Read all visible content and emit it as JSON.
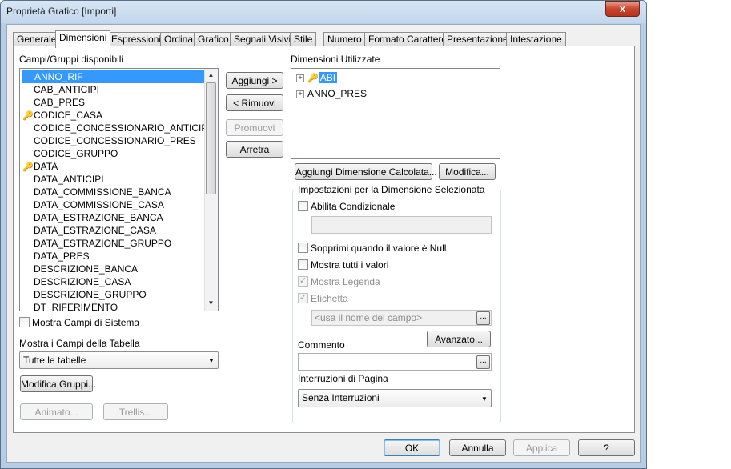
{
  "window": {
    "title": "Proprietà Grafico [Importi]",
    "close_glyph": "x"
  },
  "tabs": [
    {
      "label": "Generale"
    },
    {
      "label": "Dimensioni"
    },
    {
      "label": "Espressioni"
    },
    {
      "label": "Ordina"
    },
    {
      "label": "Grafico"
    },
    {
      "label": "Segnali Visivi"
    },
    {
      "label": "Stile"
    },
    {
      "label": "Numero"
    },
    {
      "label": "Formato Carattere"
    },
    {
      "label": "Presentazione"
    },
    {
      "label": "Intestazione"
    }
  ],
  "available": {
    "label": "Campi/Gruppi disponibili",
    "items": [
      {
        "text": "ANNO_RIF",
        "key": false
      },
      {
        "text": "CAB_ANTICIPI",
        "key": false
      },
      {
        "text": "CAB_PRES",
        "key": false
      },
      {
        "text": "CODICE_CASA",
        "key": true
      },
      {
        "text": "CODICE_CONCESSIONARIO_ANTICIPI",
        "key": false
      },
      {
        "text": "CODICE_CONCESSIONARIO_PRES",
        "key": false
      },
      {
        "text": "CODICE_GRUPPO",
        "key": false
      },
      {
        "text": "DATA",
        "key": true
      },
      {
        "text": "DATA_ANTICIPI",
        "key": false
      },
      {
        "text": "DATA_COMMISSIONE_BANCA",
        "key": false
      },
      {
        "text": "DATA_COMMISSIONE_CASA",
        "key": false
      },
      {
        "text": "DATA_ESTRAZIONE_BANCA",
        "key": false
      },
      {
        "text": "DATA_ESTRAZIONE_CASA",
        "key": false
      },
      {
        "text": "DATA_ESTRAZIONE_GRUPPO",
        "key": false
      },
      {
        "text": "DATA_PRES",
        "key": false
      },
      {
        "text": "DESCRIZIONE_BANCA",
        "key": false
      },
      {
        "text": "DESCRIZIONE_CASA",
        "key": false
      },
      {
        "text": "DESCRIZIONE_GRUPPO",
        "key": false
      },
      {
        "text": "DT_RIFERIMENTO",
        "key": false
      }
    ],
    "show_system_fields": "Mostra Campi di Sistema",
    "show_fields_of_table": "Mostra i Campi della Tabella",
    "table_select_value": "Tutte le tabelle",
    "edit_groups": "Modifica Gruppi...",
    "animate": "Animato...",
    "trellis": "Trellis..."
  },
  "middle_buttons": {
    "add": "Aggiungi >",
    "remove": "< Rimuovi",
    "promote": "Promuovi",
    "demote": "Arretra"
  },
  "used": {
    "label": "Dimensioni Utilizzate",
    "items": [
      {
        "text": "ABI",
        "key": true
      },
      {
        "text": "ANNO_PRES",
        "key": false
      }
    ],
    "add_calculated": "Aggiungi Dimensione Calcolata...",
    "edit": "Modifica..."
  },
  "settings": {
    "title": "Impostazioni per la Dimensione Selezionata",
    "enable_conditional": "Abilita Condizionale",
    "suppress_null": "Sopprimi quando il valore è Null",
    "show_all_values": "Mostra tutti i valori",
    "show_legend": "Mostra Legenda",
    "label": "Etichetta",
    "label_placeholder": "<usa il nome del campo>",
    "advanced": "Avanzato...",
    "comment": "Commento",
    "page_breaks": "Interruzioni di Pagina",
    "page_breaks_value": "Senza Interruzioni",
    "ellipsis": "..."
  },
  "footer": {
    "ok": "OK",
    "cancel": "Annulla",
    "apply": "Applica",
    "help": "?"
  }
}
